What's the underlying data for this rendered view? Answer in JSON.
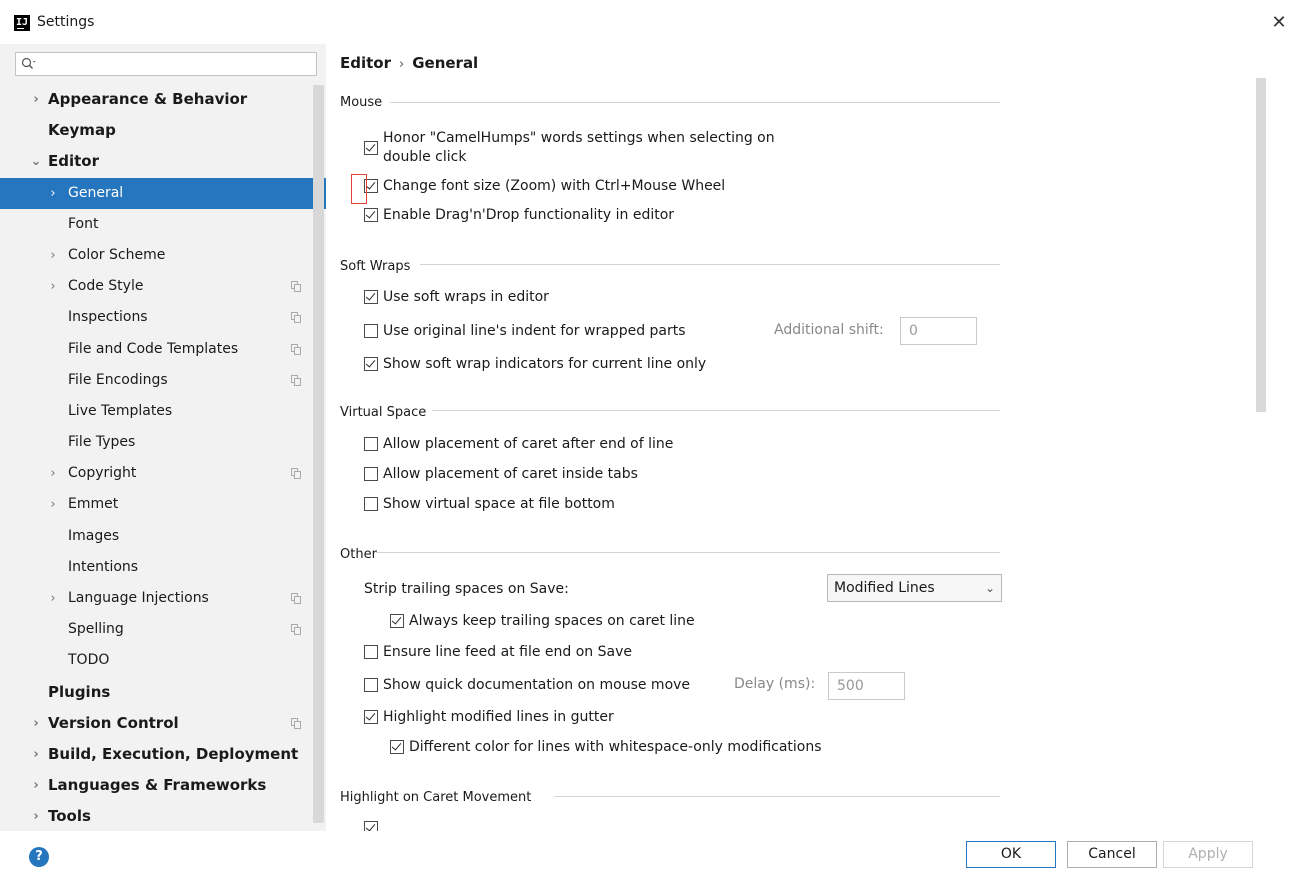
{
  "window": {
    "title": "Settings",
    "logo_text": "IJ"
  },
  "sidebar": {
    "search_placeholder": "",
    "items": [
      {
        "label": "Appearance & Behavior",
        "arrow": "›",
        "bold": true,
        "indent": 0,
        "copy": false
      },
      {
        "label": "Keymap",
        "arrow": "",
        "bold": true,
        "indent": 0,
        "copy": false
      },
      {
        "label": "Editor",
        "arrow": "⌄",
        "bold": true,
        "indent": 0,
        "copy": false
      },
      {
        "label": "General",
        "arrow": "›",
        "bold": false,
        "indent": 1,
        "copy": false,
        "selected": true
      },
      {
        "label": "Font",
        "arrow": "",
        "bold": false,
        "indent": 1,
        "copy": false
      },
      {
        "label": "Color Scheme",
        "arrow": "›",
        "bold": false,
        "indent": 1,
        "copy": false
      },
      {
        "label": "Code Style",
        "arrow": "›",
        "bold": false,
        "indent": 1,
        "copy": true
      },
      {
        "label": "Inspections",
        "arrow": "",
        "bold": false,
        "indent": 1,
        "copy": true
      },
      {
        "label": "File and Code Templates",
        "arrow": "",
        "bold": false,
        "indent": 1,
        "copy": true
      },
      {
        "label": "File Encodings",
        "arrow": "",
        "bold": false,
        "indent": 1,
        "copy": true
      },
      {
        "label": "Live Templates",
        "arrow": "",
        "bold": false,
        "indent": 1,
        "copy": false
      },
      {
        "label": "File Types",
        "arrow": "",
        "bold": false,
        "indent": 1,
        "copy": false
      },
      {
        "label": "Copyright",
        "arrow": "›",
        "bold": false,
        "indent": 1,
        "copy": true
      },
      {
        "label": "Emmet",
        "arrow": "›",
        "bold": false,
        "indent": 1,
        "copy": false
      },
      {
        "label": "Images",
        "arrow": "",
        "bold": false,
        "indent": 1,
        "copy": false
      },
      {
        "label": "Intentions",
        "arrow": "",
        "bold": false,
        "indent": 1,
        "copy": false
      },
      {
        "label": "Language Injections",
        "arrow": "›",
        "bold": false,
        "indent": 1,
        "copy": true
      },
      {
        "label": "Spelling",
        "arrow": "",
        "bold": false,
        "indent": 1,
        "copy": true
      },
      {
        "label": "TODO",
        "arrow": "",
        "bold": false,
        "indent": 1,
        "copy": false
      },
      {
        "label": "Plugins",
        "arrow": "",
        "bold": true,
        "indent": 0,
        "copy": false
      },
      {
        "label": "Version Control",
        "arrow": "›",
        "bold": true,
        "indent": 0,
        "copy": true
      },
      {
        "label": "Build, Execution, Deployment",
        "arrow": "›",
        "bold": true,
        "indent": 0,
        "copy": false
      },
      {
        "label": "Languages & Frameworks",
        "arrow": "›",
        "bold": true,
        "indent": 0,
        "copy": false
      },
      {
        "label": "Tools",
        "arrow": "›",
        "bold": true,
        "indent": 0,
        "copy": false
      }
    ]
  },
  "breadcrumb": {
    "parent": "Editor",
    "separator": "›",
    "current": "General"
  },
  "sections": {
    "mouse": {
      "title": "Mouse",
      "camel_humps_line1": "Honor \"CamelHumps\" words settings when selecting on",
      "camel_humps_line2": "double click",
      "zoom": "Change font size (Zoom) with Ctrl+Mouse Wheel",
      "drag_drop": "Enable Drag'n'Drop functionality in editor"
    },
    "soft_wraps": {
      "title": "Soft Wraps",
      "use_soft_wraps": "Use soft wraps in editor",
      "original_indent": "Use original line's indent for wrapped parts",
      "additional_shift_label": "Additional shift:",
      "additional_shift_value": "0",
      "show_indicators": "Show soft wrap indicators for current line only"
    },
    "virtual_space": {
      "title": "Virtual Space",
      "after_end": "Allow placement of caret after end of line",
      "inside_tabs": "Allow placement of caret inside tabs",
      "file_bottom": "Show virtual space at file bottom"
    },
    "other": {
      "title": "Other",
      "strip_label": "Strip trailing spaces on Save:",
      "strip_value": "Modified Lines",
      "keep_caret": "Always keep trailing spaces on caret line",
      "line_feed": "Ensure line feed at file end on Save",
      "quick_doc": "Show quick documentation on mouse move",
      "delay_label": "Delay (ms):",
      "delay_value": "500",
      "highlight_modified": "Highlight modified lines in gutter",
      "different_color": "Different color for lines with whitespace-only modifications"
    },
    "caret_movement": {
      "title": "Highlight on Caret Movement"
    }
  },
  "footer": {
    "ok": "OK",
    "cancel": "Cancel",
    "apply": "Apply",
    "help": "?"
  },
  "colors": {
    "selection": "#2675bf",
    "sidebar_bg": "#f2f2f2",
    "highlight_border": "#e0403a"
  }
}
